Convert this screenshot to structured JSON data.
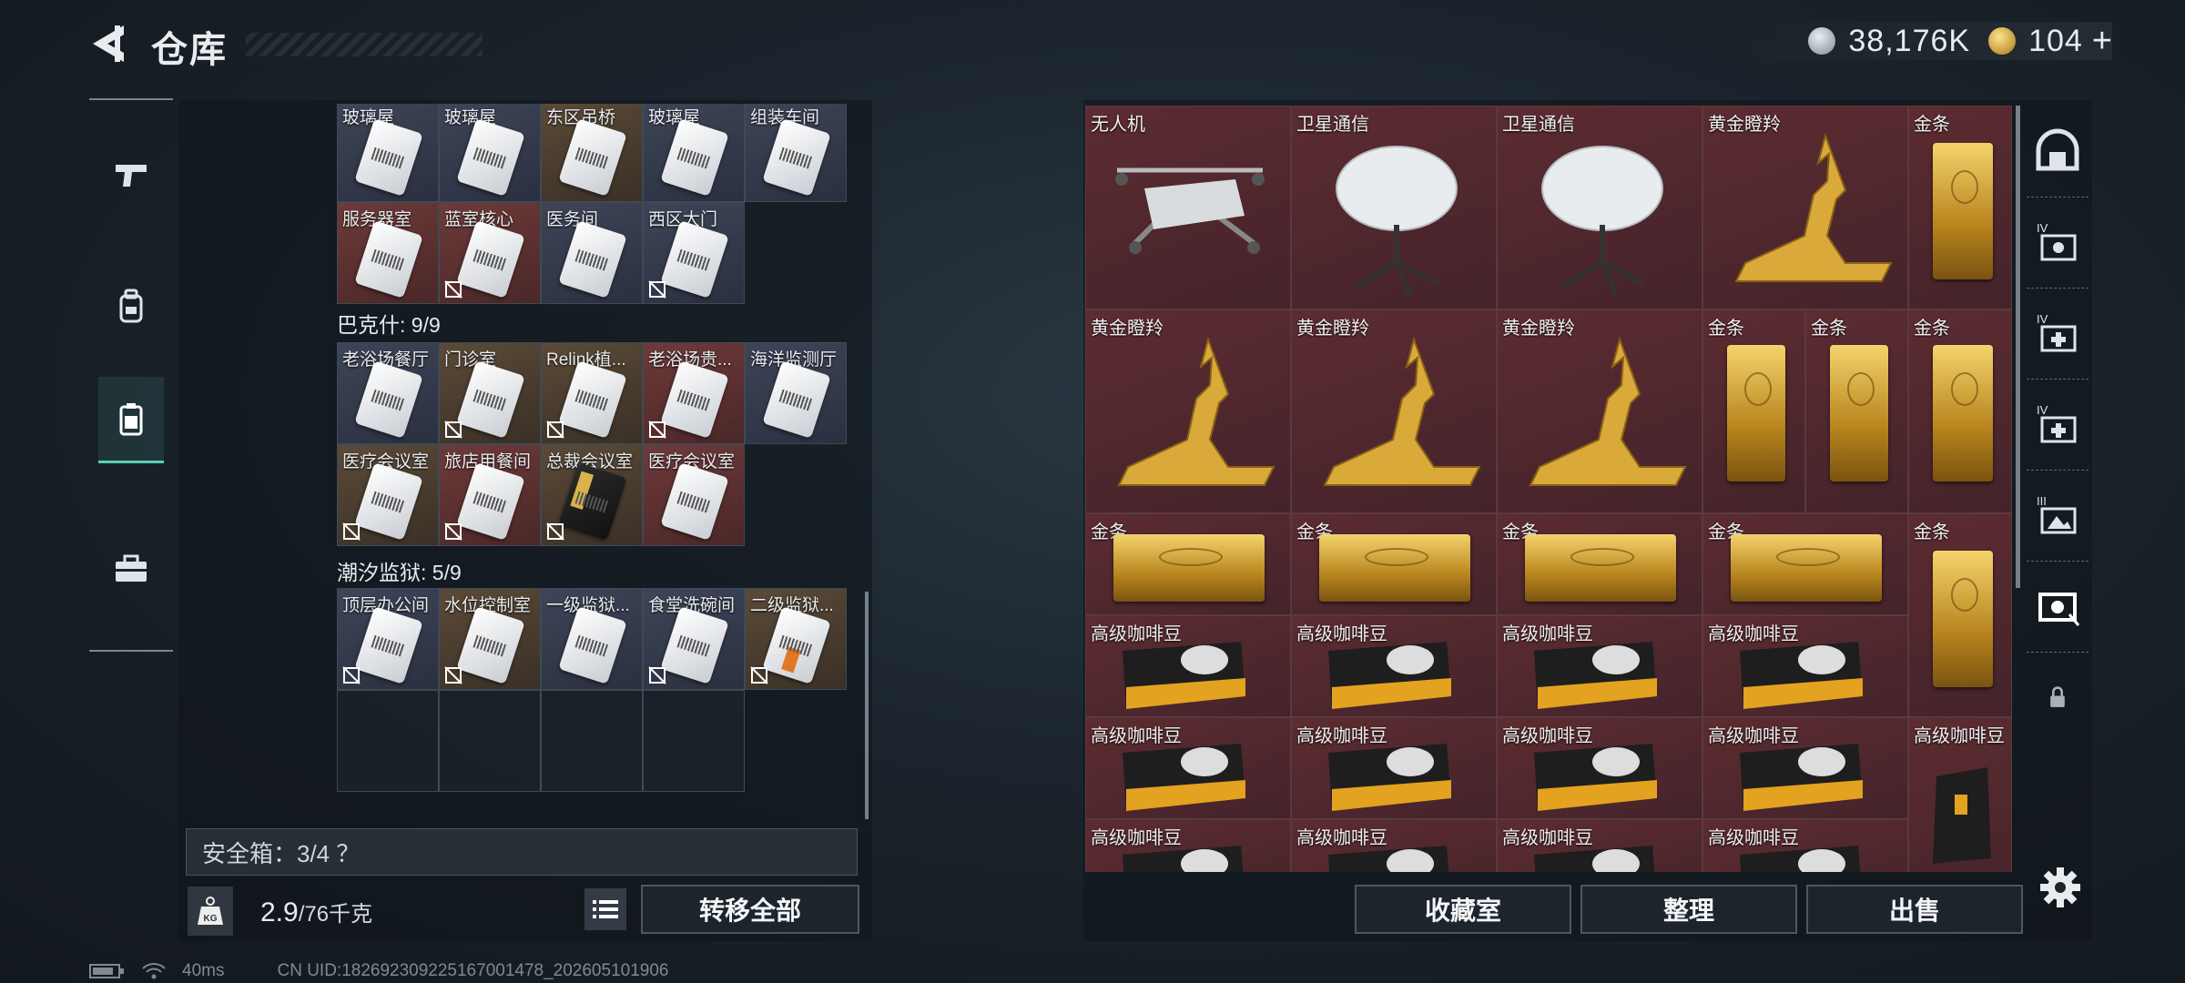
{
  "header": {
    "title": "仓库"
  },
  "currency": {
    "silver": "38,176K",
    "gold": "104",
    "plus": "+"
  },
  "left": {
    "sections": [
      {
        "label": "巴克什: 9/9"
      },
      {
        "label": "潮汐监狱: 5/9"
      }
    ],
    "rows": [
      [
        "玻璃屋",
        "玻璃屋",
        "东区吊桥",
        "玻璃屋",
        "组装车间"
      ],
      [
        "服务器室",
        "蓝室核心",
        "医务间",
        "西区大门"
      ],
      [
        "老浴场餐厅",
        "门诊室",
        "Relink植...",
        "老浴场贵...",
        "海洋监测厅"
      ],
      [
        "医疗会议室",
        "旅店用餐间",
        "总裁会议室",
        "医疗会议室"
      ],
      [
        "顶层办公间",
        "水位控制室",
        "一级监狱...",
        "食堂洗碗间",
        "二级监狱..."
      ]
    ],
    "safe_box": "安全箱：3/4 ？",
    "weight_current": "2.9",
    "weight_max": "/76千克",
    "weight_icon_text": "KG",
    "transfer_all": "转移全部"
  },
  "right": {
    "items": [
      "无人机",
      "卫星通信",
      "卫星通信",
      "黄金瞪羚",
      "金条",
      "黄金瞪羚",
      "黄金瞪羚",
      "黄金瞪羚",
      "金条",
      "金条",
      "金条",
      "金条",
      "金条",
      "金条",
      "金条",
      "金条",
      "高级咖啡豆",
      "高级咖啡豆",
      "高级咖啡豆",
      "高级咖啡豆",
      "高级咖啡豆",
      "高级咖啡豆",
      "高级咖啡豆",
      "高级咖啡豆",
      "高级咖啡豆",
      "高级咖啡豆",
      "高级咖啡豆",
      "高级咖啡豆",
      "高级咖啡豆"
    ],
    "buttons": {
      "collection": "收藏室",
      "sort": "整理",
      "sell": "出售"
    },
    "side_icon_labels": [
      "IV",
      "IV",
      "IV",
      "III"
    ]
  },
  "status": {
    "ping": "40ms",
    "uid": "CN UID:182692309225167001478_202605101906"
  },
  "colors": {
    "accent": "#5bd0b8",
    "item_red": "#5c2c31",
    "gold": "#d9a93a"
  }
}
